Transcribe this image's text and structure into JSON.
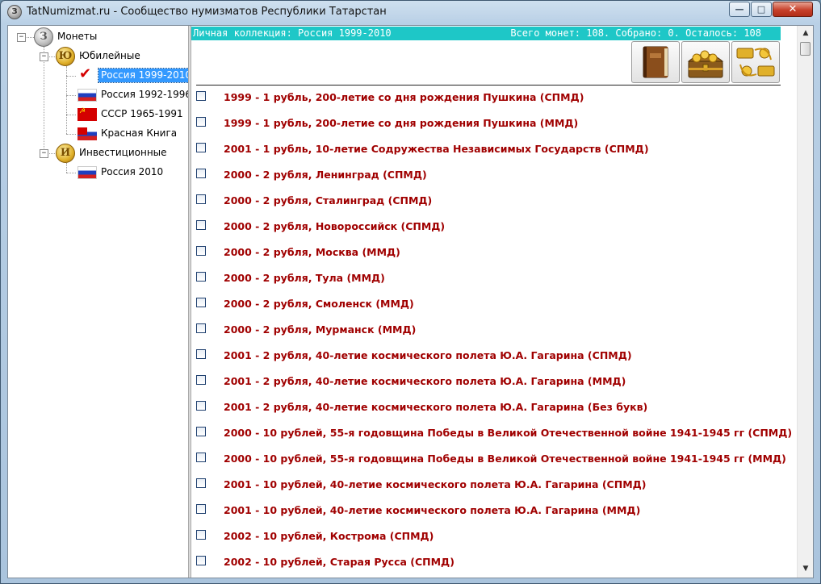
{
  "window": {
    "title": "TatNumizmat.ru - Сообщество нумизматов Республики Татарстан",
    "app_icon_glyph": "З",
    "controls": {
      "minimize": "—",
      "maximize": "□",
      "close": "✕"
    }
  },
  "tree": {
    "root": {
      "label": "Монеты",
      "icon": "silver-coin-icon",
      "glyph": "З"
    },
    "groups": [
      {
        "label": "Юбилейные",
        "icon": "gold-coin-icon",
        "glyph": "Ю"
      },
      {
        "label": "Инвестиционные",
        "icon": "gold-coin-icon",
        "glyph": "И"
      }
    ],
    "items": [
      {
        "label": "Россия 1999-2010",
        "icon": "checkmark-icon",
        "selected": true
      },
      {
        "label": "Россия 1992-1996",
        "icon": "russia-flag-icon"
      },
      {
        "label": "СССР 1965-1991",
        "icon": "ussr-flag-icon"
      },
      {
        "label": "Красная Книга",
        "icon": "red-book-flag-icon"
      },
      {
        "label": "Россия 2010",
        "icon": "russia-flag-icon"
      }
    ]
  },
  "header": {
    "left": "Личная коллекция: Россия 1999-2010",
    "right": "Всего монет: 108. Собрано: 0. Осталось: 108",
    "bg_color": "#1ec7c7"
  },
  "toolbar": [
    {
      "name": "album-button",
      "icon": "album-book-icon"
    },
    {
      "name": "treasure-chest-button",
      "icon": "treasure-chest-icon"
    },
    {
      "name": "exchange-button",
      "icon": "coin-exchange-icon"
    }
  ],
  "coins": [
    "1999 - 1 рубль, 200-летие со дня рождения Пушкина (СПМД)",
    "1999 - 1 рубль, 200-летие со дня рождения Пушкина (ММД)",
    "2001 - 1 рубль, 10-летие Содружества Независимых Государств (СПМД)",
    "2000 - 2 рубля, Ленинград (СПМД)",
    "2000 - 2 рубля, Сталинград (СПМД)",
    "2000 - 2 рубля, Новороссийск (СПМД)",
    "2000 - 2 рубля, Москва (ММД)",
    "2000 - 2 рубля, Тула (ММД)",
    "2000 - 2 рубля, Смоленск (ММД)",
    "2000 - 2 рубля, Мурманск (ММД)",
    "2001 - 2 рубля, 40-летие космического полета Ю.А. Гагарина (СПМД)",
    "2001 - 2 рубля, 40-летие космического полета Ю.А. Гагарина (ММД)",
    "2001 - 2 рубля, 40-летие космического полета Ю.А. Гагарина (Без букв)",
    "2000 - 10 рублей, 55-я годовщина Победы в Великой Отечественной войне 1941-1945 гг (СПМД)",
    "2000 - 10 рублей, 55-я годовщина Победы в Великой Отечественной войне 1941-1945 гг (ММД)",
    "2001 - 10 рублей, 40-летие космического полета Ю.А. Гагарина (СПМД)",
    "2001 - 10 рублей, 40-летие космического полета Ю.А. Гагарина (ММД)",
    "2002 - 10 рублей, Кострома (СПМД)",
    "2002 - 10 рублей, Старая Русса (СПМД)"
  ],
  "colors": {
    "coin_text": "#a00000",
    "selection": "#3399ff"
  },
  "scrollbar": {
    "up_glyph": "▲",
    "down_glyph": "▼"
  }
}
